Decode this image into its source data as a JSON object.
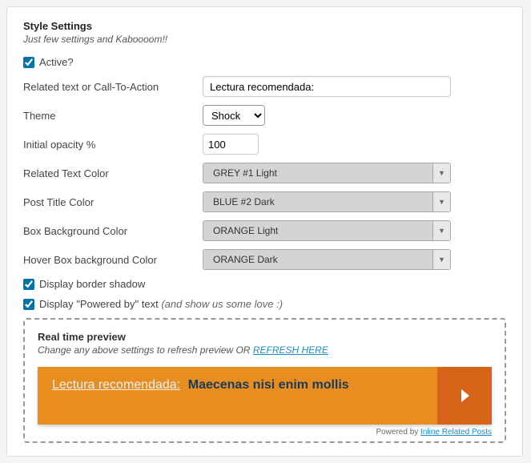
{
  "heading": "Style Settings",
  "subheading": "Just few settings and Kaboooom!!",
  "active": {
    "label": "Active?",
    "checked": true
  },
  "fields": {
    "related_text": {
      "label": "Related text or Call-To-Action",
      "value": "Lectura recomendada:"
    },
    "theme": {
      "label": "Theme",
      "value": "Shock"
    },
    "opacity": {
      "label": "Initial opacity %",
      "value": "100"
    },
    "rel_color": {
      "label": "Related Text Color",
      "value": "GREY #1 Light"
    },
    "title_color": {
      "label": "Post Title Color",
      "value": "BLUE #2 Dark"
    },
    "box_bg": {
      "label": "Box Background Color",
      "value": "ORANGE Light"
    },
    "hover_bg": {
      "label": "Hover Box background Color",
      "value": "ORANGE Dark"
    }
  },
  "border_shadow": {
    "label": "Display border shadow",
    "checked": true
  },
  "powered_by": {
    "label": "Display \"Powered by\" text",
    "love": "(and show us some love :)",
    "checked": true
  },
  "preview": {
    "title": "Real time preview",
    "sub_prefix": "Change any above settings to refresh preview OR ",
    "refresh": "REFRESH HERE",
    "cta_label": "Lectura recomendada:",
    "post_title": "Maecenas nisi enim mollis",
    "powered_prefix": "Powered by ",
    "powered_link": "Inline Related Posts"
  }
}
